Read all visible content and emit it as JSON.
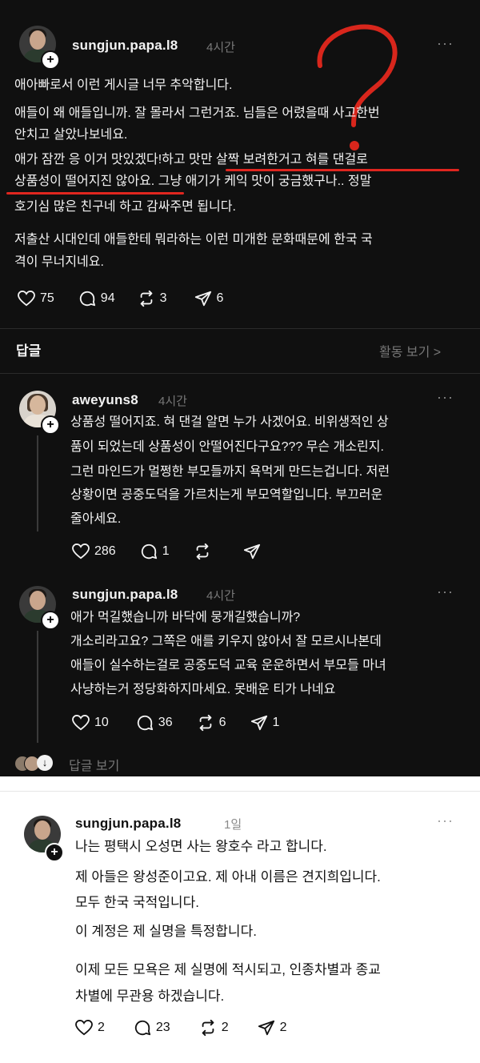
{
  "post": {
    "username": "sungjun.papa.l8",
    "time": "4시간",
    "more": "···",
    "lines": [
      "애아빠로서 이런 게시글 너무 추악합니다.",
      "애들이 왜 애들입니까. 잘 몰라서 그런거죠. 님들은 어렸을때 사고한번",
      "안치고 살았나보네요.",
      "애가 잠깐 응 이거 맛있겠다!하고 맛만 살짝 보려한거고 혀를 댄걸로",
      "상품성이 떨어지진 않아요. 그냥 애기가 케익 맛이 궁금했구나.. 정말",
      "호기심 많은 친구네 하고 감싸주면 됩니다.",
      "저출산 시대인데 애들한테 뭐라하는 이런 미개한 문화때문에 한국 국",
      "격이 무너지네요."
    ],
    "likes": "75",
    "comments": "94",
    "reposts": "3",
    "shares": "6"
  },
  "replies_header": {
    "label": "답글",
    "activity": "활동 보기 >"
  },
  "reply1": {
    "username": "aweyuns8",
    "time": "4시간",
    "more": "···",
    "lines": [
      "상품성 떨어지죠. 혀 댄걸 알면 누가 사겠어요. 비위생적인 상",
      "품이 되었는데 상품성이 안떨어진다구요??? 무슨 개소린지.",
      "그런 마인드가 멀쩡한 부모들까지 욕먹게 만드는겁니다. 저런",
      "상황이면 공중도덕을 가르치는게 부모역할입니다. 부끄러운",
      "줄아세요."
    ],
    "likes": "286",
    "comments": "1"
  },
  "reply2": {
    "username": "sungjun.papa.l8",
    "time": "4시간",
    "more": "···",
    "lines": [
      "애가 먹길했습니까 바닥에 뭉개길했습니까?",
      "개소리라고요? 그쪽은 애를 키우지 않아서 잘 모르시나본데",
      "애들이 실수하는걸로 공중도덕 교육 운운하면서 부모들 마녀",
      "사냥하는거 정당화하지마세요. 못배운 티가 나네요"
    ],
    "likes": "10",
    "comments": "36",
    "reposts": "6",
    "shares": "1"
  },
  "view_replies": "답글 보기",
  "post2": {
    "username": "sungjun.papa.l8",
    "time": "1일",
    "more": "···",
    "lines": [
      "나는 평택시 오성면 사는 왕호수 라고 합니다.",
      "제 아들은 왕성준이고요. 제 아내 이름은 견지희입니다.",
      "모두 한국 국적입니다.",
      "이 계정은 제 실명을 특정합니다.",
      "이제 모든 모욕은 제 실명에 적시되고, 인종차별과 종교",
      "차별에 무관용 하겠습니다."
    ],
    "likes": "2",
    "comments": "23",
    "reposts": "2",
    "shares": "2"
  },
  "colors": {
    "dark_bg": "#101010",
    "annotation_red": "#e0261f"
  },
  "icons": [
    "heart-icon",
    "comment-icon",
    "repost-icon",
    "share-icon",
    "plus-icon",
    "more-icon",
    "chevron-right-icon"
  ]
}
